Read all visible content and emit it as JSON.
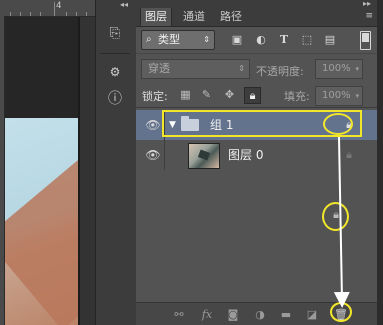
{
  "canvas": {
    "ruler_label": "4"
  },
  "panel": {
    "tabs": [
      {
        "label": "图层",
        "active": true
      },
      {
        "label": "通道",
        "active": false
      },
      {
        "label": "路径",
        "active": false
      }
    ],
    "filter": {
      "kind_label": "类型",
      "icons": [
        "image-filter-icon",
        "adjustment-filter-icon",
        "type-filter-icon",
        "shape-filter-icon",
        "smart-object-filter-icon"
      ]
    },
    "blend_mode": "穿透",
    "opacity_label": "不透明度:",
    "opacity_value": "100%",
    "lock_label": "锁定:",
    "fill_label": "填充:",
    "fill_value": "100%",
    "layers": [
      {
        "name": "组 1",
        "type": "group",
        "selected": true,
        "locked": true
      },
      {
        "name": "图层 0",
        "type": "layer",
        "selected": false,
        "locked": true
      }
    ],
    "bottom_icons": [
      "link-icon",
      "fx-icon",
      "mask-icon",
      "adjustment-icon",
      "group-icon",
      "new-layer-icon",
      "trash-icon"
    ]
  },
  "colors": {
    "highlight": "#f2e62a",
    "selected_layer": "#63738d",
    "panel_bg": "#535353"
  }
}
